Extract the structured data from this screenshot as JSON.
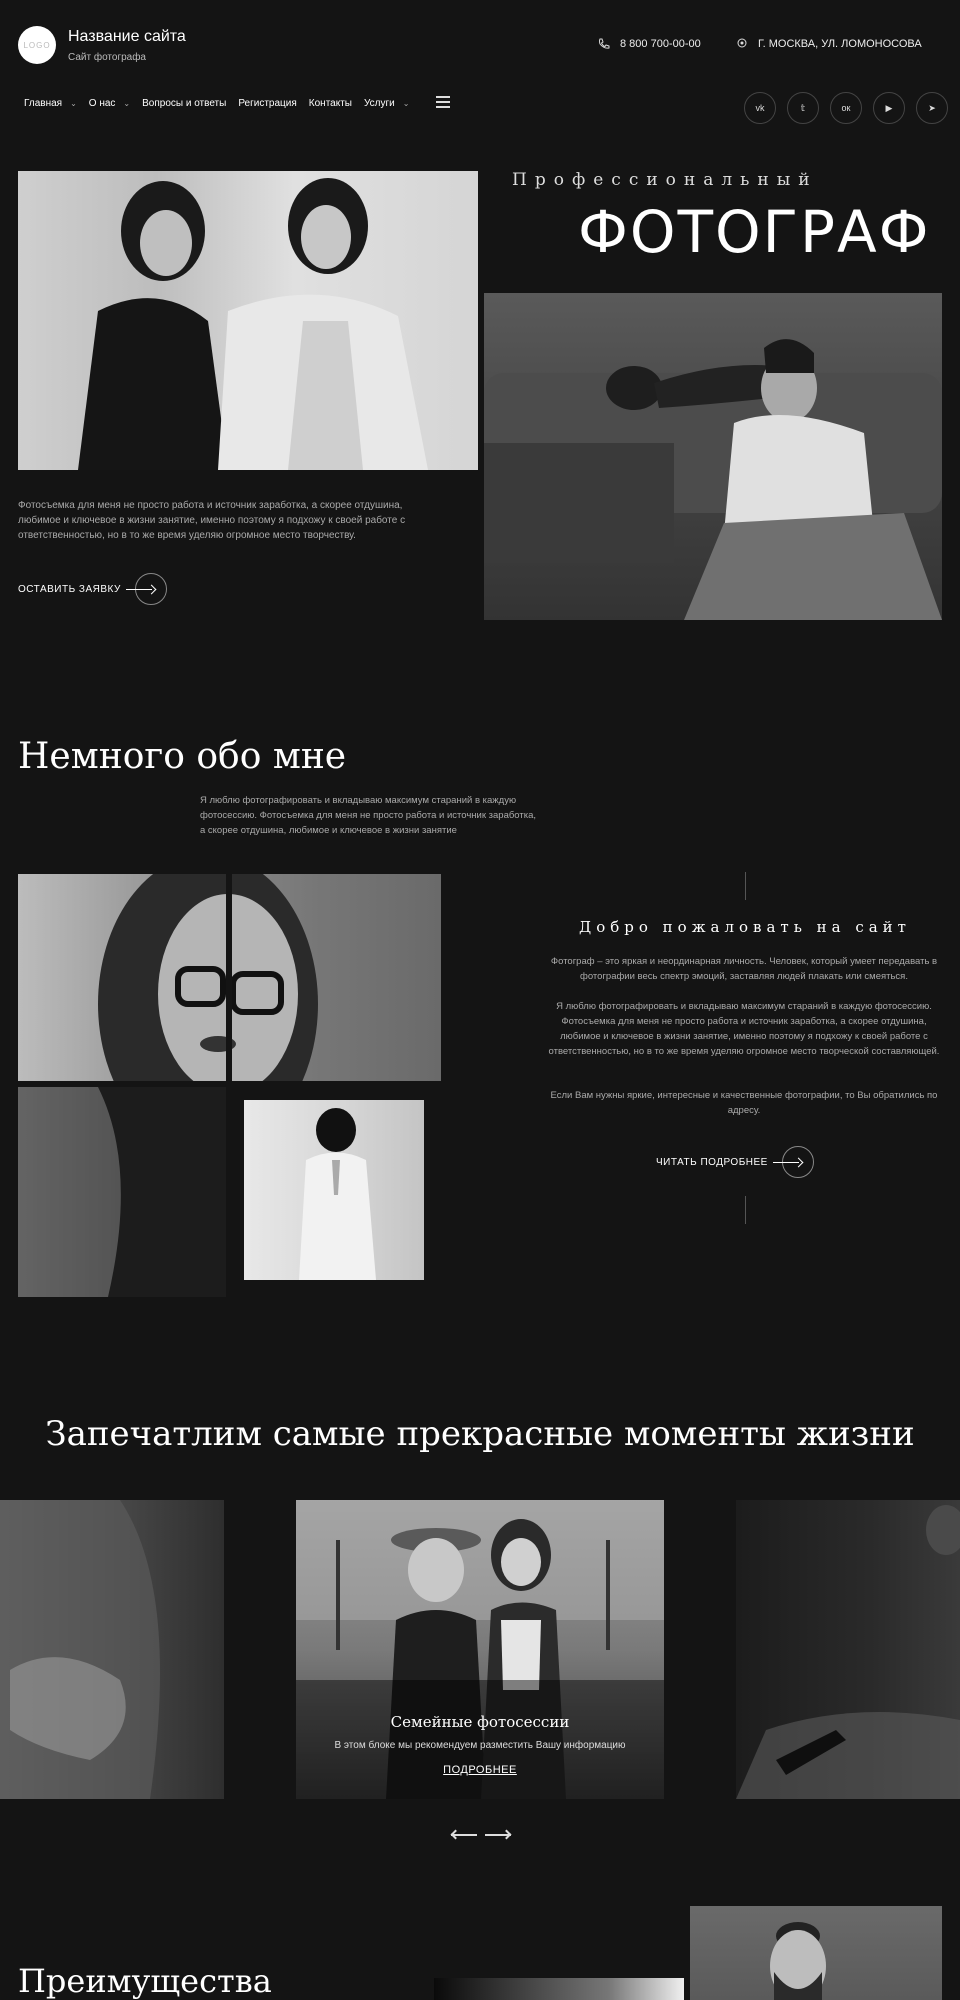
{
  "header": {
    "logo_text": "LOGO",
    "site_name": "Название сайта",
    "site_subtitle": "Сайт фотографа",
    "phone": "8 800 700-00-00",
    "address": "Г. МОСКВА, УЛ. ЛОМОНОСОВА"
  },
  "nav": {
    "items": [
      {
        "label": "Главная",
        "has_dropdown": true
      },
      {
        "label": "О нас",
        "has_dropdown": true
      },
      {
        "label": "Вопросы и ответы",
        "has_dropdown": false
      },
      {
        "label": "Регистрация",
        "has_dropdown": false
      },
      {
        "label": "Контакты",
        "has_dropdown": false
      },
      {
        "label": "Услуги",
        "has_dropdown": true
      }
    ],
    "chevron": "⌄",
    "socials": [
      "vk",
      "twitter",
      "odnoklassniki",
      "youtube",
      "telegram"
    ],
    "social_glyphs": [
      "vk",
      "𝕥",
      "ок",
      "▶",
      "➤"
    ]
  },
  "hero": {
    "subtitle": "Профессиональный",
    "title": "ФОТОГРАФ",
    "text": "Фотосъемка для меня не просто работа и источник заработка, а скорее отдушина, любимое и ключевое в жизни занятие, именно поэтому я подхожу к своей работе с ответственностью, но в то же время уделяю огромное место творчеству.",
    "cta": "ОСТАВИТЬ ЗАЯВКУ"
  },
  "about": {
    "title": "Немного обо мне",
    "text": "Я люблю фотографировать и вкладываю максимум стараний в каждую фотосессию. Фотосъемка для меня не просто работа и источник заработка, а скорее отдушина, любимое и ключевое в жизни занятие",
    "welcome_title": "Добро пожаловать на сайт",
    "paragraphs": [
      "Фотограф – это яркая и неординарная личность. Человек, который умеет передавать в фотографии весь спектр эмоций, заставляя людей плакать или смеяться.",
      "Я люблю фотографировать и вкладываю максимум стараний в каждую фотосессию. Фотосъемка для меня не просто работа и источник заработка, а скорее отдушина, любимое и ключевое в жизни занятие, именно поэтому я подхожу к своей работе с ответственностью, но в то же время уделяю огромное место творческой составляющей.",
      "Если Вам нужны яркие, интересные и качественные фотографии, то Вы обратились по адресу."
    ],
    "cta": "ЧИТАТЬ ПОДРОБНЕЕ"
  },
  "moments": {
    "title": "Запечатлим самые прекрасные моменты жизни",
    "active_slide": {
      "name": "Семейные фотосессии",
      "desc": "В этом блоке мы рекомендуем разместить Вашу информацию",
      "more": "ПОДРОБНЕЕ"
    }
  },
  "advantages": {
    "title": "Преимущества"
  },
  "colors": {
    "background": "#141414",
    "text": "#ffffff",
    "muted_text": "#aaaaaa"
  }
}
